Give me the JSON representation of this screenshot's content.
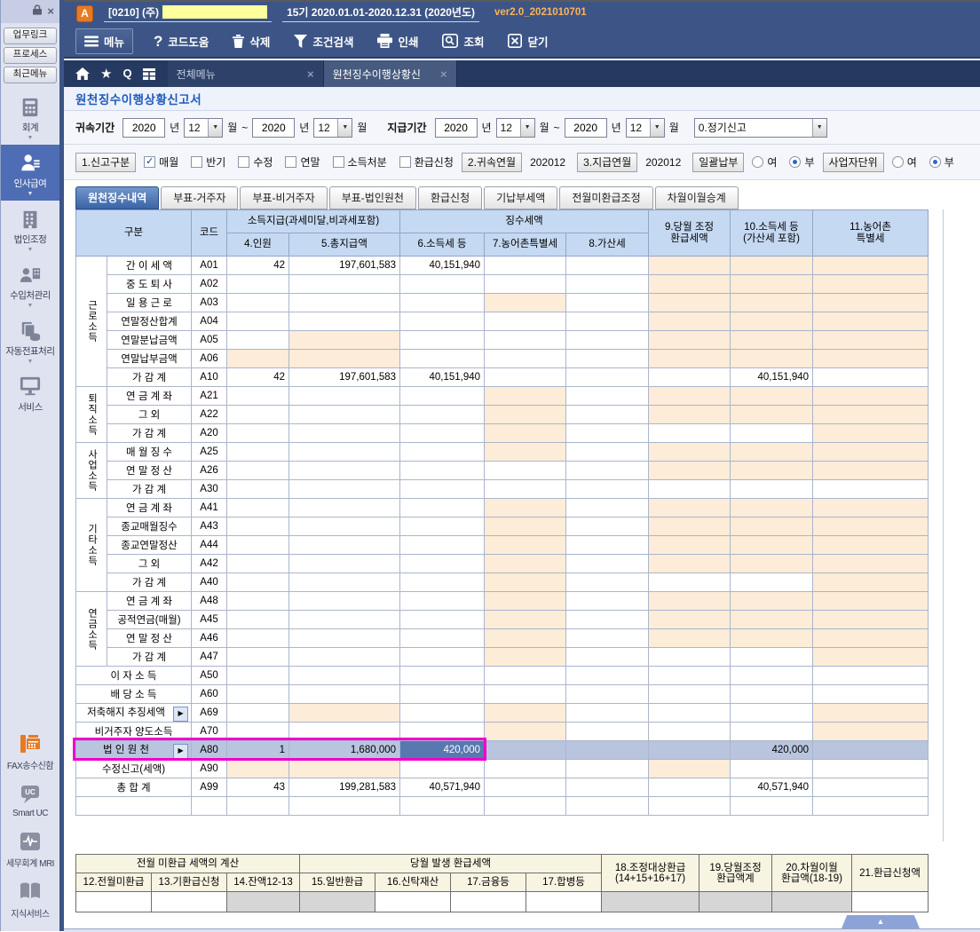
{
  "window": {
    "app_badge": "A",
    "company": "[0210]  (주)",
    "fiscal": "15기  2020.01.01-2020.12.31  (2020년도)",
    "version": "ver2.0_2021010701"
  },
  "sidebar": {
    "window_controls": [
      "lock-icon",
      "close-icon"
    ],
    "top_buttons": [
      {
        "label": "업무링크"
      },
      {
        "label": "프로세스"
      },
      {
        "label": "최근메뉴"
      }
    ],
    "menu": [
      {
        "label": "회계",
        "icon": "calculator-icon",
        "active": false,
        "caret": true
      },
      {
        "label": "인사급여",
        "icon": "payroll-person-icon",
        "active": true,
        "caret": true
      },
      {
        "label": "법인조정",
        "icon": "building-icon",
        "active": false,
        "caret": true
      },
      {
        "label": "수입처관리",
        "icon": "client-manage-icon",
        "active": false,
        "caret": true
      },
      {
        "label": "자동전표처리",
        "icon": "auto-voucher-icon",
        "active": false,
        "caret": true
      },
      {
        "label": "서비스",
        "icon": "monitor-icon",
        "active": false,
        "caret": false
      }
    ],
    "bottom_menu": [
      {
        "label": "FAX송수신함",
        "icon": "fax-icon"
      },
      {
        "label": "Smart UC",
        "icon": "uc-chat-icon"
      },
      {
        "label": "세무회계 MRI",
        "icon": "mri-wave-icon"
      },
      {
        "label": "지식서비스",
        "icon": "book-icon"
      }
    ]
  },
  "toolbar": {
    "buttons": [
      {
        "label": "메뉴",
        "icon": "hamburger-icon"
      },
      {
        "label": "코드도움",
        "icon": "question-icon"
      },
      {
        "label": "삭제",
        "icon": "trash-icon"
      },
      {
        "label": "조건검색",
        "icon": "funnel-icon"
      },
      {
        "label": "인쇄",
        "icon": "printer-icon"
      },
      {
        "label": "조회",
        "icon": "search-icon"
      },
      {
        "label": "닫기",
        "icon": "close-box-icon"
      }
    ]
  },
  "tabbar": {
    "left_icons": [
      "home-icon",
      "star-icon",
      "q-search-icon",
      "grid-icon"
    ],
    "tabs": [
      {
        "label": "전체메뉴",
        "active": false
      },
      {
        "label": "원천징수이행상황신",
        "active": true
      }
    ]
  },
  "page_title": "원천징수이행상황신고서",
  "filters": {
    "attribution_label": "귀속기간",
    "payment_label": "지급기간",
    "year_suffix": "년",
    "month_suffix": "월",
    "range_tilde": "~",
    "attr_from": {
      "year": "2020",
      "month": "12"
    },
    "attr_to": {
      "year": "2020",
      "month": "12"
    },
    "pay_from": {
      "year": "2020",
      "month": "12"
    },
    "pay_to": {
      "year": "2020",
      "month": "12"
    },
    "report_type": "0.정기신고",
    "report_class": {
      "label": "1.신고구분",
      "options": [
        {
          "label": "매월",
          "checked": true
        },
        {
          "label": "반기",
          "checked": false
        },
        {
          "label": "수정",
          "checked": false
        },
        {
          "label": "연말",
          "checked": false
        },
        {
          "label": "소득처분",
          "checked": false
        },
        {
          "label": "환급신청",
          "checked": false
        }
      ]
    },
    "attr_ym_label": "2.귀속연월",
    "attr_ym": "202012",
    "pay_ym_label": "3.지급연월",
    "pay_ym": "202012",
    "lump_sum": {
      "label": "일괄납부",
      "options": [
        {
          "label": "여",
          "selected": false
        },
        {
          "label": "부",
          "selected": true
        }
      ]
    },
    "biz_unit": {
      "label": "사업자단위",
      "options": [
        {
          "label": "여",
          "selected": false
        },
        {
          "label": "부",
          "selected": true
        }
      ]
    }
  },
  "subtabs": {
    "active": 0,
    "tabs": [
      "원천징수내역",
      "부표-거주자",
      "부표-비거주자",
      "부표-법인원천",
      "환급신청",
      "기납부세액",
      "전월미환급조정",
      "차월이월승계"
    ]
  },
  "main_table": {
    "headers": {
      "gubun": "구분",
      "code": "코드",
      "income_group": "소득지급(과세미달,비과세포함)",
      "c4": "4.인원",
      "c5": "5.총지급액",
      "levy_group": "징수세액",
      "c6": "6.소득세 등",
      "c7": "7.농어촌특별세",
      "c8": "8.가산세",
      "c9": "9.당월 조정\n환급세액",
      "c10": "10.소득세 등\n(가산세 포함)",
      "c11": "11.농어촌\n특별세"
    },
    "rows": [
      {
        "group": "근로소득",
        "span": 7,
        "label": "간 이 세 액",
        "code": "A01",
        "c4": "42",
        "c5": "197,601,583",
        "c6": "40,151,940",
        "shaded": [
          "c9",
          "c10",
          "c11"
        ]
      },
      {
        "label": "중 도 퇴 사",
        "code": "A02",
        "shaded": [
          "c9",
          "c10",
          "c11"
        ]
      },
      {
        "label": "일 용 근 로",
        "code": "A03",
        "shaded": [
          "c7",
          "c9",
          "c10",
          "c11"
        ]
      },
      {
        "label": "연말정산합계",
        "code": "A04",
        "shaded": [
          "c9",
          "c10",
          "c11"
        ]
      },
      {
        "label": "연말분납금액",
        "code": "A05",
        "shaded": [
          "c5",
          "c9",
          "c10",
          "c11"
        ]
      },
      {
        "label": "연말납부금액",
        "code": "A06",
        "shaded": [
          "c4",
          "c5",
          "c9",
          "c10",
          "c11"
        ]
      },
      {
        "label": "가 감 계",
        "code": "A10",
        "c4": "42",
        "c5": "197,601,583",
        "c6": "40,151,940",
        "c10": "40,151,940",
        "shaded": []
      },
      {
        "group": "퇴직소득",
        "span": 3,
        "label": "연 금 계 좌",
        "code": "A21",
        "shaded": [
          "c7",
          "c9",
          "c10",
          "c11"
        ]
      },
      {
        "label": "그 외",
        "code": "A22",
        "shaded": [
          "c7",
          "c9",
          "c10",
          "c11"
        ]
      },
      {
        "label": "가 감 계",
        "code": "A20",
        "shaded": [
          "c7",
          "c11"
        ]
      },
      {
        "group": "사업소득",
        "span": 3,
        "label": "매 월 징 수",
        "code": "A25",
        "shaded": [
          "c7",
          "c9",
          "c10",
          "c11"
        ]
      },
      {
        "label": "연 말 정 산",
        "code": "A26",
        "shaded": [
          "c9",
          "c10",
          "c11"
        ]
      },
      {
        "label": "가 감 계",
        "code": "A30",
        "shaded": []
      },
      {
        "group": "기타소득",
        "span": 5,
        "label": "연 금 계 좌",
        "code": "A41",
        "shaded": [
          "c7",
          "c9",
          "c10",
          "c11"
        ]
      },
      {
        "label": "종교매월징수",
        "code": "A43",
        "shaded": [
          "c7",
          "c9",
          "c10",
          "c11"
        ]
      },
      {
        "label": "종교연말정산",
        "code": "A44",
        "shaded": [
          "c7",
          "c9",
          "c10",
          "c11"
        ]
      },
      {
        "label": "그 외",
        "code": "A42",
        "shaded": [
          "c7",
          "c9",
          "c10",
          "c11"
        ]
      },
      {
        "label": "가 감 계",
        "code": "A40",
        "shaded": [
          "c7",
          "c11"
        ]
      },
      {
        "group": "연금소득",
        "span": 4,
        "label": "연 금 계 좌",
        "code": "A48",
        "shaded": [
          "c7",
          "c9",
          "c10",
          "c11"
        ]
      },
      {
        "label": "공적연금(매월)",
        "code": "A45",
        "shaded": [
          "c7",
          "c9",
          "c10",
          "c11"
        ]
      },
      {
        "label": "연 말 정 산",
        "code": "A46",
        "shaded": [
          "c7",
          "c9",
          "c10",
          "c11"
        ]
      },
      {
        "label": "가 감 계",
        "code": "A47",
        "shaded": [
          "c7",
          "c11"
        ]
      },
      {
        "label": "이 자 소 득",
        "code": "A50",
        "wide": true,
        "shaded": []
      },
      {
        "label": "배 당 소 득",
        "code": "A60",
        "wide": true,
        "shaded": []
      },
      {
        "label": "저축해지 추징세액",
        "code": "A69",
        "wide": true,
        "arrow": true,
        "shaded": [
          "c5",
          "c7",
          "c11"
        ]
      },
      {
        "label": "비거주자 양도소득",
        "code": "A70",
        "wide": true,
        "shaded": [
          "c7",
          "c11"
        ]
      },
      {
        "label": "법 인 원 천",
        "code": "A80",
        "wide": true,
        "arrow": true,
        "highlight": true,
        "selected_cell": "c6",
        "c4": "1",
        "c5": "1,680,000",
        "c6": "420,000",
        "c10": "420,000",
        "shaded": []
      },
      {
        "label": "수정신고(세액)",
        "code": "A90",
        "wide": true,
        "shaded": [
          "c4",
          "c5",
          "c9"
        ]
      },
      {
        "label": "총 합 계",
        "code": "A99",
        "wide": true,
        "c4": "43",
        "c5": "199,281,583",
        "c6": "40,571,940",
        "c10": "40,571,940",
        "shaded": []
      },
      {
        "label": "",
        "code": "",
        "wide": true,
        "empty": true,
        "shaded": []
      }
    ]
  },
  "bottom_table": {
    "prev_group": "전월 미환급 세액의 계산",
    "cur_group": "당월 발생 환급세액",
    "cols": [
      "12.전월미환급",
      "13.기환급신청",
      "14.잔액12-13",
      "15.일반환급",
      "16.신탁재산",
      "17.금융등",
      "17.합병등"
    ],
    "c18": "18.조정대상환급\n(14+15+16+17)",
    "c19": "19.당월조정\n환급액계",
    "c20": "20.차월이월\n환급액(18-19)",
    "c21": "21.환급신청액",
    "values": [
      "",
      "",
      "",
      "",
      "",
      "",
      "",
      "",
      "",
      "",
      ""
    ],
    "disabled": [
      2,
      3,
      7,
      8,
      9
    ]
  },
  "colors": {
    "titlebar": "#3d5586",
    "tabstrip": "#263a61",
    "accent_blue": "#4f6db5",
    "header_blue": "#c5d9f2",
    "shaded_orange": "#fdecd8",
    "highlight_row": "#b9c4de",
    "selected_cell": "#5878b0",
    "highlight_border": "#ee00cc",
    "version_orange": "#ffb357",
    "fax_orange": "#e87a24",
    "bottom_header": "#f8f4e2"
  },
  "misc": {
    "collapse_button": "▲",
    "caret_down": "▼",
    "row_arrow": "▶",
    "check_glyph": "✓",
    "tab_close": "×"
  }
}
